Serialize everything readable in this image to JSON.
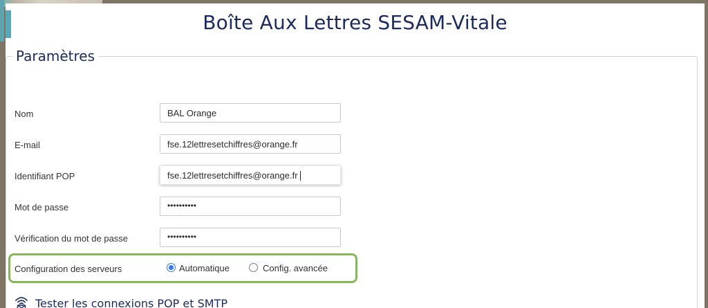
{
  "title": "Boîte Aux Lettres SESAM-Vitale",
  "section": {
    "legend": "Paramètres"
  },
  "fields": {
    "nom": {
      "label": "Nom",
      "value": "BAL Orange"
    },
    "email": {
      "label": "E-mail",
      "value": "fse.12lettresetchiffres@orange.fr"
    },
    "pop_id": {
      "label": "Identifiant POP",
      "value": "fse.12lettresetchiffres@orange.fr"
    },
    "password": {
      "label": "Mot de passe",
      "value": "••••••••••"
    },
    "password_check": {
      "label": "Vérification du mot de passe",
      "value": "••••••••••"
    }
  },
  "server_config": {
    "label": "Configuration des serveurs",
    "options": [
      {
        "label": "Automatique",
        "checked": true
      },
      {
        "label": "Config. avancée",
        "checked": false
      }
    ]
  },
  "test_action": {
    "label": "Tester les connexions POP et SMTP",
    "icon": "wifi-mail-icon"
  },
  "colors": {
    "title": "#1b2a5e",
    "highlight": "#85b858",
    "radio_accent": "#3478f6",
    "backdrop": "#7e7564"
  }
}
